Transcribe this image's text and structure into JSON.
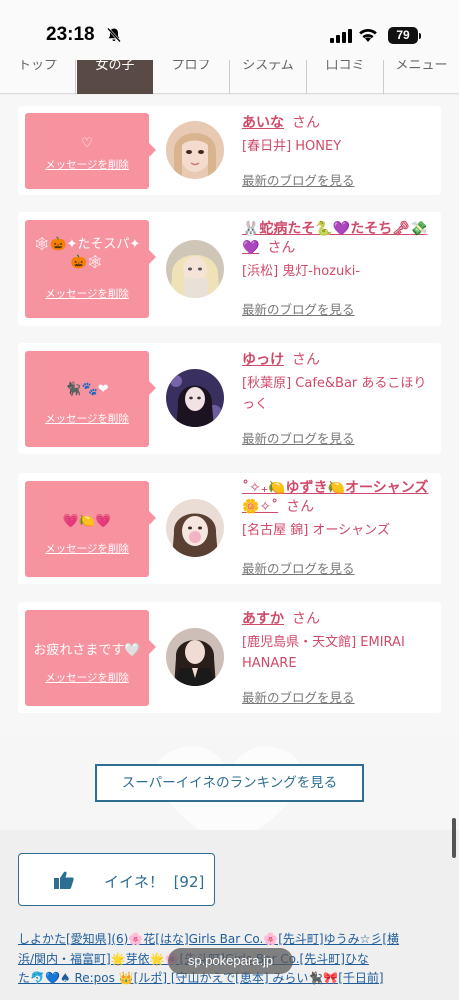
{
  "status": {
    "time": "23:18",
    "battery": "79"
  },
  "nav": {
    "tabs": [
      {
        "label": "トップ"
      },
      {
        "label": "女の子"
      },
      {
        "label": "プロフ"
      },
      {
        "label": "システム"
      },
      {
        "label": "口コミ"
      },
      {
        "label": "メニュー"
      }
    ]
  },
  "messages": [
    {
      "message": "♡",
      "delete_label": "メッセージを削除",
      "name": "あいな",
      "honorific": "さん",
      "shop": "[春日井] HONEY",
      "blog_label": "最新のブログを見る"
    },
    {
      "message": "🕸🎃✦たそスパ✦🎃🕸",
      "delete_label": "メッセージを削除",
      "name": "🐰蛇病たそ🐍💜たそち🗝💸💜",
      "honorific": "さん",
      "shop": "[浜松] 鬼灯-hozuki-",
      "blog_label": "最新のブログを見る"
    },
    {
      "message": "🐈‍⬛🐾❤",
      "delete_label": "メッセージを削除",
      "name": "ゆっけ",
      "honorific": "さん",
      "shop": "[秋葉原] Cafe&Bar あるこほりっく",
      "blog_label": "最新のブログを見る"
    },
    {
      "message": "💗🍋💗",
      "delete_label": "メッセージを削除",
      "name": "˚✧₊🍋ゆずき🍋オーシャンズ🌼✧˚",
      "honorific": "さん",
      "shop": "[名古屋 錦] オーシャンズ",
      "blog_label": "最新のブログを見る"
    },
    {
      "message": "お疲れさまです🤍",
      "delete_label": "メッセージを削除",
      "name": "あすか",
      "honorific": "さん",
      "shop": "[鹿児島県・天文館] EMIRAI HANARE",
      "blog_label": "最新のブログを見る"
    }
  ],
  "ranking_button": "スーパーイイネのランキングを見る",
  "like": {
    "label": "イイネ！",
    "count": "[92]"
  },
  "tags": {
    "line1": "しよかた[愛知県](6)🌸花[はな]Girls Bar Co.🌸[先斗町]ゆうみ☆彡[横",
    "line2": "浜/関内・福富町]🌟芽依🌟🌸[先斗町]Girls Bar Co.[先斗町]ひな",
    "line3": "た🐬💙♠ Re:pos 👑[ルポ] [守山かえで[恵本] みらい🐈‍⬛🎀[千日前]"
  },
  "url_pill": "sp.pokepara.jp"
}
